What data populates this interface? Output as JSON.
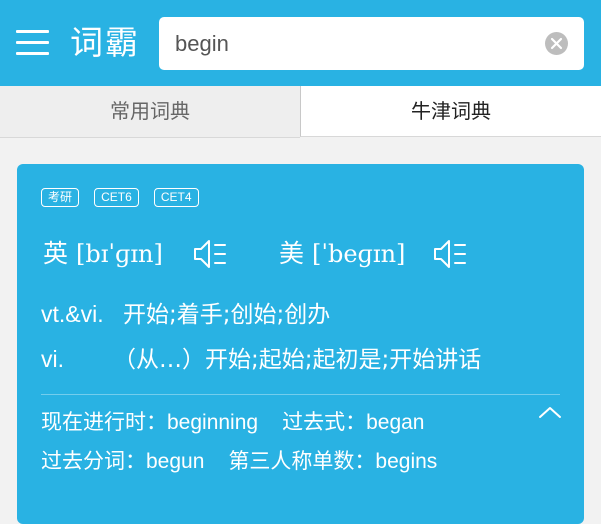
{
  "header": {
    "logo": "词霸",
    "search_value": "begin",
    "search_placeholder": "",
    "background": "#29b2e3"
  },
  "tabs": [
    {
      "label": "常用词典",
      "active": false
    },
    {
      "label": "牛津词典",
      "active": true
    }
  ],
  "card": {
    "tags": [
      "考研",
      "CET6",
      "CET4"
    ],
    "pronunciation": {
      "uk": {
        "region": "英",
        "ipa": "[bɪˈɡɪn]"
      },
      "us": {
        "region": "美",
        "ipa": "[ˈbeɡɪn]"
      }
    },
    "definitions": [
      {
        "pos": "vt.&vi.",
        "meaning": "开始;着手;创始;创办"
      },
      {
        "pos": "vi.",
        "meaning": "（从…）开始;起始;起初是;开始讲话"
      }
    ],
    "forms": [
      {
        "label": "现在进行时：",
        "value": "beginning"
      },
      {
        "label": "过去式：",
        "value": "began"
      },
      {
        "label": "过去分词：",
        "value": "begun"
      },
      {
        "label": "第三人称单数：",
        "value": "begins"
      }
    ]
  },
  "icons": {
    "menu": "menu-icon",
    "clear": "clear-icon",
    "speaker": "speaker-icon",
    "collapse": "chevron-up-icon"
  }
}
